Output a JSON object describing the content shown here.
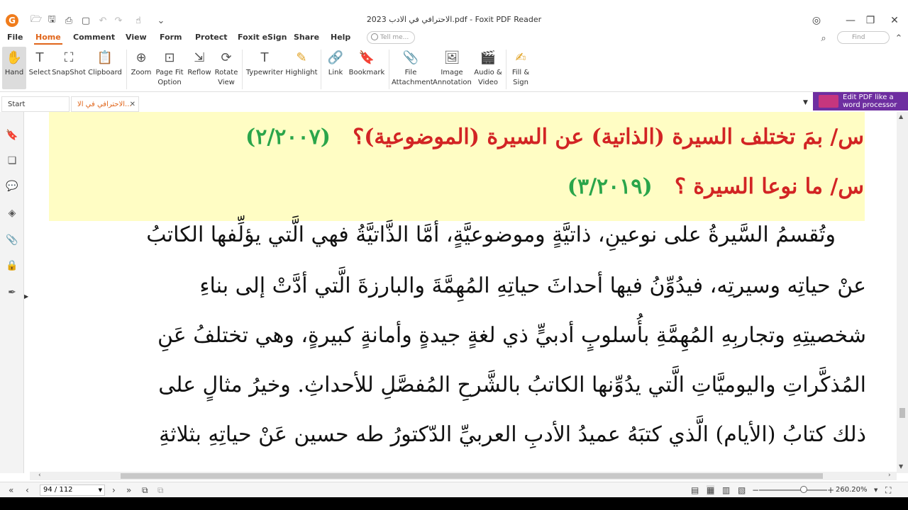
{
  "window": {
    "title": "الاحترافي في الادب 2023.pdf - Foxit PDF Reader"
  },
  "menu": [
    "File",
    "Home",
    "Comment",
    "View",
    "Form",
    "Protect",
    "Foxit eSign",
    "Share",
    "Help"
  ],
  "active_menu": "Home",
  "search": {
    "tellme_placeholder": "Tell me...",
    "find_placeholder": "Find"
  },
  "ribbon": {
    "tools": [
      {
        "label": "Hand",
        "icon": "hand-icon"
      },
      {
        "label": "Select",
        "icon": "select-text-icon"
      },
      {
        "label": "SnapShot",
        "icon": "snapshot-icon"
      },
      {
        "label": "Clipboard",
        "icon": "clipboard-icon"
      },
      {
        "label": "Zoom",
        "icon": "zoom-icon"
      },
      {
        "label": "Page Fit Option",
        "icon": "page-fit-icon"
      },
      {
        "label": "Reflow",
        "icon": "reflow-icon"
      },
      {
        "label": "Rotate View",
        "icon": "rotate-icon"
      },
      {
        "label": "Typewriter",
        "icon": "typewriter-icon"
      },
      {
        "label": "Highlight",
        "icon": "highlight-icon"
      },
      {
        "label": "Link",
        "icon": "link-icon"
      },
      {
        "label": "Bookmark",
        "icon": "bookmark-icon"
      },
      {
        "label": "File Attachment",
        "icon": "file-attachment-icon"
      },
      {
        "label": "Image Annotation",
        "icon": "image-annotation-icon"
      },
      {
        "label": "Audio & Video",
        "icon": "audio-video-icon"
      },
      {
        "label": "Fill & Sign",
        "icon": "fill-sign-icon"
      }
    ]
  },
  "tabs": {
    "start": "Start",
    "document": "الاحترافي في الا..."
  },
  "ad": {
    "line1": "Edit PDF like a",
    "line2": "word processor"
  },
  "document": {
    "q1": {
      "text": "س/ بمَ تختلف السيرة (الذاتية) عن السيرة (الموضوعية)؟",
      "year": "(٢/٢٠٠٧)"
    },
    "q2": {
      "text": "س/ ما نوعا السيرة ؟",
      "year": "(٣/٢٠١٩)"
    },
    "lines": [
      "وتُقسمُ السَّيرةُ على نوعينِ، ذاتيَّةٍ وموضوعيَّةٍ، أمَّا الذَّاتيَّةُ فهي الَّتي يؤلِّفها الكاتبُ",
      "عنْ حياتِه وسيرتِه، فيدُوِّنُ فيها أحداثَ حياتِهِ المُهِمَّةَ والبارزةَ الَّتي أدَّتْ إلى بناءِ",
      "شخصيتِهِ وتجاربِهِ المُهِمَّةِ بأُسلوبٍ أدبيٍّ ذي لغةٍ جيدةٍ وأمانةٍ كبيرةٍ، وهي تختلفُ عَنِ",
      "المُذكَّراتِ واليوميَّاتِ الَّتي يدُوِّنها الكاتبُ بالشَّرحِ المُفصَّلِ للأحداثِ. وخيرُ مثالٍ على",
      "ذلك كتابُ (الأيام) الَّذي كتبَهُ عميدُ الأدبِ العربيِّ الدّكتورُ طه حسين عَنْ حياتِهِ بثلاثةِ"
    ]
  },
  "status": {
    "page": "94 / 112",
    "zoom": "260.20%"
  }
}
